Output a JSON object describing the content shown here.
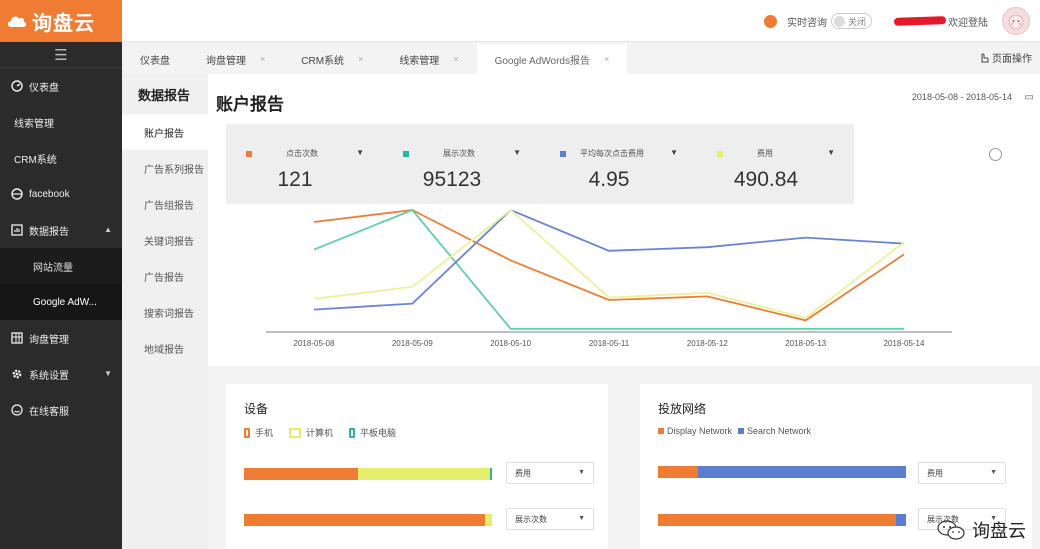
{
  "brand": {
    "name": "询盘云"
  },
  "header": {
    "realtime_label": "实时咨询",
    "toggle_label": "关闭",
    "welcome_text": "欢迎登陆"
  },
  "sidebar": {
    "items": [
      {
        "label": "仪表盘"
      },
      {
        "label": "线索管理"
      },
      {
        "label": "CRM系统"
      },
      {
        "label": "facebook"
      },
      {
        "label": "数据报告"
      },
      {
        "label": "网站流量"
      },
      {
        "label": "Google AdW..."
      },
      {
        "label": "询盘管理"
      },
      {
        "label": "系统设置"
      },
      {
        "label": "在线客服"
      }
    ]
  },
  "tabs": [
    {
      "label": "仪表盘"
    },
    {
      "label": "询盘管理"
    },
    {
      "label": "CRM系统"
    },
    {
      "label": "线索管理"
    },
    {
      "label": "Google AdWords报告"
    }
  ],
  "page_ops_label": "页面操作",
  "subnav": {
    "title": "数据报告",
    "items": [
      {
        "label": "账户报告"
      },
      {
        "label": "广告系列报告"
      },
      {
        "label": "广告组报告"
      },
      {
        "label": "关键词报告"
      },
      {
        "label": "广告报告"
      },
      {
        "label": "搜索词报告"
      },
      {
        "label": "地域报告"
      }
    ]
  },
  "main": {
    "title": "账户报告",
    "date_range": "2018-05-08 - 2018-05-14"
  },
  "metrics": [
    {
      "label": "点击次数",
      "value": "121",
      "color": "#f07c34"
    },
    {
      "label": "展示次数",
      "value": "95123",
      "color": "#2bb5a0"
    },
    {
      "label": "平均每次点击费用",
      "value": "4.95",
      "color": "#5b7ed1"
    },
    {
      "label": "费用",
      "value": "490.84",
      "color": "#e3ee6a"
    }
  ],
  "chart_data": {
    "type": "line",
    "x": [
      "2018-05-08",
      "2018-05-09",
      "2018-05-10",
      "2018-05-11",
      "2018-05-12",
      "2018-05-13",
      "2018-05-14"
    ],
    "series": [
      {
        "name": "点击次数",
        "color": "#f07c34",
        "values": [
          0.9,
          1.0,
          0.58,
          0.25,
          0.28,
          0.08,
          0.63
        ]
      },
      {
        "name": "展示次数",
        "color": "#5fd0a5",
        "values": [
          0.67,
          1.0,
          0.01,
          0.01,
          0.01,
          0.01,
          0.01
        ]
      },
      {
        "name": "平均每次点击费用",
        "color": "#6b83d6",
        "values": [
          0.17,
          0.22,
          1.0,
          0.66,
          0.69,
          0.77,
          0.72
        ]
      },
      {
        "name": "费用",
        "color": "#eaf29a",
        "values": [
          0.26,
          0.36,
          1.0,
          0.27,
          0.31,
          0.1,
          0.73
        ]
      }
    ]
  },
  "device_panel": {
    "title": "设备",
    "legend": [
      {
        "label": "手机",
        "color": "#f07c34"
      },
      {
        "label": "计算机",
        "color": "#e3ee6a"
      },
      {
        "label": "平板电脑",
        "color": "#2bb5a0"
      }
    ],
    "bars": [
      {
        "metric": "费用",
        "segments": [
          0.46,
          0.53,
          0.01
        ]
      },
      {
        "metric": "展示次数",
        "segments": [
          0.97,
          0.03,
          0.0
        ]
      }
    ]
  },
  "network_panel": {
    "title": "投放网络",
    "legend": [
      {
        "label": "Display Network",
        "color": "#f07c34"
      },
      {
        "label": "Search Network",
        "color": "#5b7ed1"
      }
    ],
    "bars": [
      {
        "metric": "费用",
        "segments": [
          0.16,
          0.84
        ]
      },
      {
        "metric": "展示次数",
        "segments": [
          0.96,
          0.04
        ]
      }
    ]
  },
  "watermark": {
    "text": "询盘云"
  }
}
